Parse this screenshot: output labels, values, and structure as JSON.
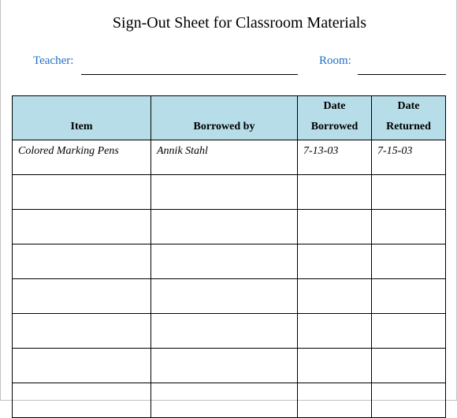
{
  "title": "Sign-Out Sheet for Classroom Materials",
  "fields": {
    "teacher_label": "Teacher:",
    "teacher_value": "",
    "room_label": "Room:",
    "room_value": ""
  },
  "table": {
    "headers": [
      {
        "line1": "",
        "line2": "Item"
      },
      {
        "line1": "",
        "line2": "Borrowed by"
      },
      {
        "line1": "Date",
        "line2": "Borrowed"
      },
      {
        "line1": "Date",
        "line2": "Returned"
      }
    ],
    "rows": [
      [
        "Colored Marking Pens",
        "Annik Stahl",
        "7-13-03",
        "7-15-03"
      ],
      [
        "",
        "",
        "",
        ""
      ],
      [
        "",
        "",
        "",
        ""
      ],
      [
        "",
        "",
        "",
        ""
      ],
      [
        "",
        "",
        "",
        ""
      ],
      [
        "",
        "",
        "",
        ""
      ],
      [
        "",
        "",
        "",
        ""
      ],
      [
        "",
        "",
        "",
        ""
      ]
    ]
  },
  "colors": {
    "header_bg": "#b7dde8",
    "label_color": "#1f6fc6"
  }
}
